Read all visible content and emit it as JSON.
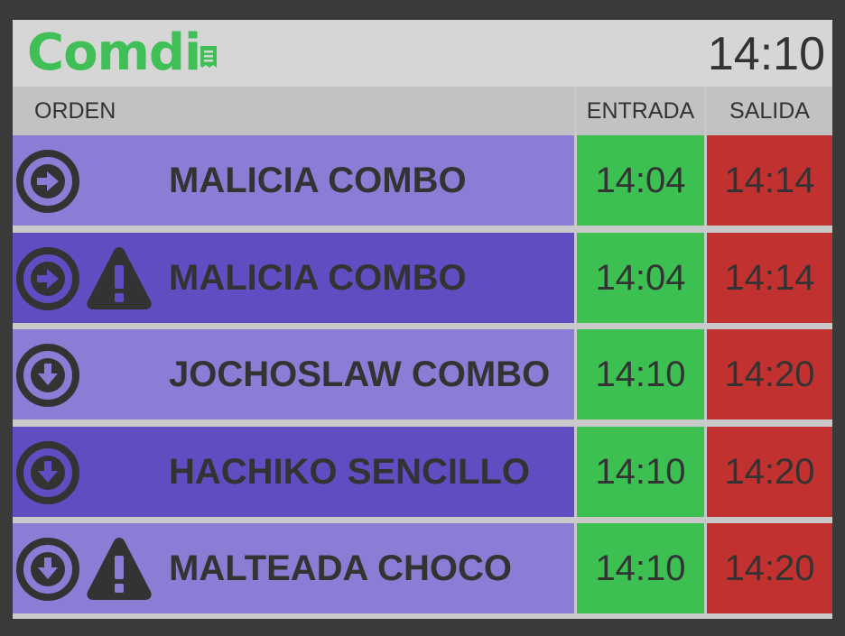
{
  "app": {
    "logo": "Comdi",
    "clock": "14:10"
  },
  "columns": {
    "orden": "ORDEN",
    "entrada": "ENTRADA",
    "salida": "SALIDA"
  },
  "colors": {
    "row_light": "#8a7dd6",
    "row_dark": "#5f4ec2",
    "entrada_bg": "#3cc052",
    "salida_bg": "#c1312f",
    "brand": "#3fbf56"
  },
  "orders": [
    {
      "name": "MALICIA COMBO",
      "entrada": "14:04",
      "salida": "14:14",
      "status_icon": "arrow-right-circle-icon",
      "warning": false,
      "shade": "light"
    },
    {
      "name": "MALICIA COMBO",
      "entrada": "14:04",
      "salida": "14:14",
      "status_icon": "arrow-right-circle-icon",
      "warning": true,
      "shade": "dark"
    },
    {
      "name": "JOCHOSLAW COMBO",
      "entrada": "14:10",
      "salida": "14:20",
      "status_icon": "arrow-down-circle-icon",
      "warning": false,
      "shade": "light"
    },
    {
      "name": "HACHIKO SENCILLO",
      "entrada": "14:10",
      "salida": "14:20",
      "status_icon": "arrow-down-circle-icon",
      "warning": false,
      "shade": "dark"
    },
    {
      "name": "MALTEADA CHOCO",
      "entrada": "14:10",
      "salida": "14:20",
      "status_icon": "arrow-down-circle-icon",
      "warning": true,
      "shade": "light"
    }
  ]
}
